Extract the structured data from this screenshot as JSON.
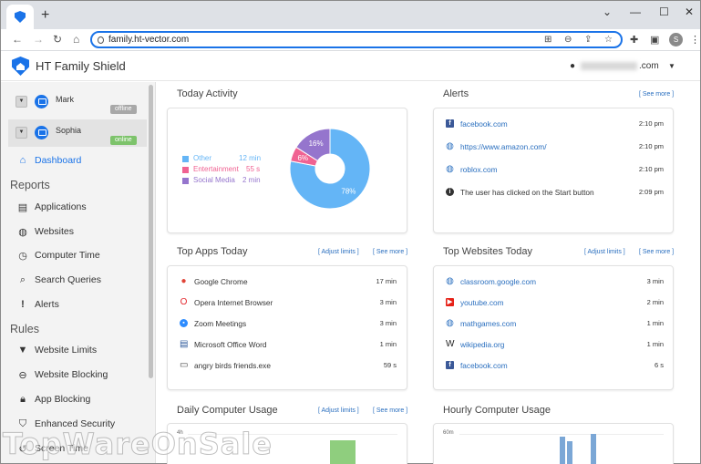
{
  "browser": {
    "url": "family.ht-vector.com",
    "new_tab": "+",
    "win_minimize": "⌄",
    "win_min": "—",
    "win_max": "☐",
    "win_close": "✕",
    "profile_initial": "S"
  },
  "app": {
    "title": "HT Family Shield",
    "user_email_suffix": ".com",
    "accent": "#1a73e8"
  },
  "sidebar": {
    "devices": [
      {
        "name": "Mark",
        "status": "offline",
        "status_color": "#a8a8a8"
      },
      {
        "name": "Sophia",
        "status": "online",
        "status_color": "#7dc36b"
      }
    ],
    "dashboard": "Dashboard",
    "reports_heading": "Reports",
    "reports": [
      "Applications",
      "Websites",
      "Computer Time",
      "Search Queries",
      "Alerts"
    ],
    "rules_heading": "Rules",
    "rules": [
      "Website Limits",
      "Website Blocking",
      "App Blocking",
      "Enhanced Security",
      "Screen Time"
    ]
  },
  "today_activity": {
    "title": "Today Activity",
    "legend": [
      {
        "label": "Other",
        "value": "12 min",
        "color": "#64b5f6"
      },
      {
        "label": "Entertainment",
        "value": "55 s",
        "color": "#f06292"
      },
      {
        "label": "Social Media",
        "value": "2 min",
        "color": "#9575cd"
      }
    ],
    "chart_data": {
      "type": "pie",
      "categories": [
        "Other",
        "Entertainment",
        "Social Media"
      ],
      "values": [
        78,
        6,
        16
      ],
      "labels": [
        "78%",
        "6%",
        "16%"
      ]
    }
  },
  "alerts": {
    "title": "Alerts",
    "see_more": "[ See more ]",
    "rows": [
      {
        "icon": "facebook-icon",
        "text": "facebook.com",
        "time": "2:10 pm",
        "link": true
      },
      {
        "icon": "globe-icon",
        "text": "https://www.amazon.com/",
        "time": "2:10 pm",
        "link": true
      },
      {
        "icon": "globe-icon",
        "text": "roblox.com",
        "time": "2:10 pm",
        "link": true
      },
      {
        "icon": "info-icon",
        "text": "The user has clicked on the Start button",
        "time": "2:09 pm",
        "link": false
      }
    ]
  },
  "top_apps": {
    "title": "Top Apps Today",
    "adjust": "[ Adjust limits ]",
    "see_more": "[ See more ]",
    "rows": [
      {
        "icon": "chrome-icon",
        "text": "Google Chrome",
        "time": "17 min"
      },
      {
        "icon": "opera-icon",
        "text": "Opera Internet Browser",
        "time": "3 min"
      },
      {
        "icon": "zoom-icon",
        "text": "Zoom Meetings",
        "time": "3 min"
      },
      {
        "icon": "word-icon",
        "text": "Microsoft Office Word",
        "time": "1 min"
      },
      {
        "icon": "window-icon",
        "text": "angry birds friends.exe",
        "time": "59 s"
      }
    ]
  },
  "top_websites": {
    "title": "Top Websites Today",
    "adjust": "[ Adjust limits ]",
    "see_more": "[ See more ]",
    "rows": [
      {
        "icon": "globe-icon",
        "text": "classroom.google.com",
        "time": "3 min"
      },
      {
        "icon": "youtube-icon",
        "text": "youtube.com",
        "time": "2 min"
      },
      {
        "icon": "globe-icon",
        "text": "mathgames.com",
        "time": "1 min"
      },
      {
        "icon": "wikipedia-icon",
        "text": "wikipedia.org",
        "time": "1 min"
      },
      {
        "icon": "facebook-icon",
        "text": "facebook.com",
        "time": "6 s"
      }
    ]
  },
  "daily_usage": {
    "title": "Daily Computer Usage",
    "adjust": "[ Adjust limits ]",
    "see_more": "[ See more ]",
    "y_tick": "4h",
    "bar_color": "#8fce7e"
  },
  "hourly_usage": {
    "title": "Hourly Computer Usage",
    "y_tick": "60m",
    "bar_color": "#7ba7d6"
  },
  "watermark": "TopWareOnSale"
}
